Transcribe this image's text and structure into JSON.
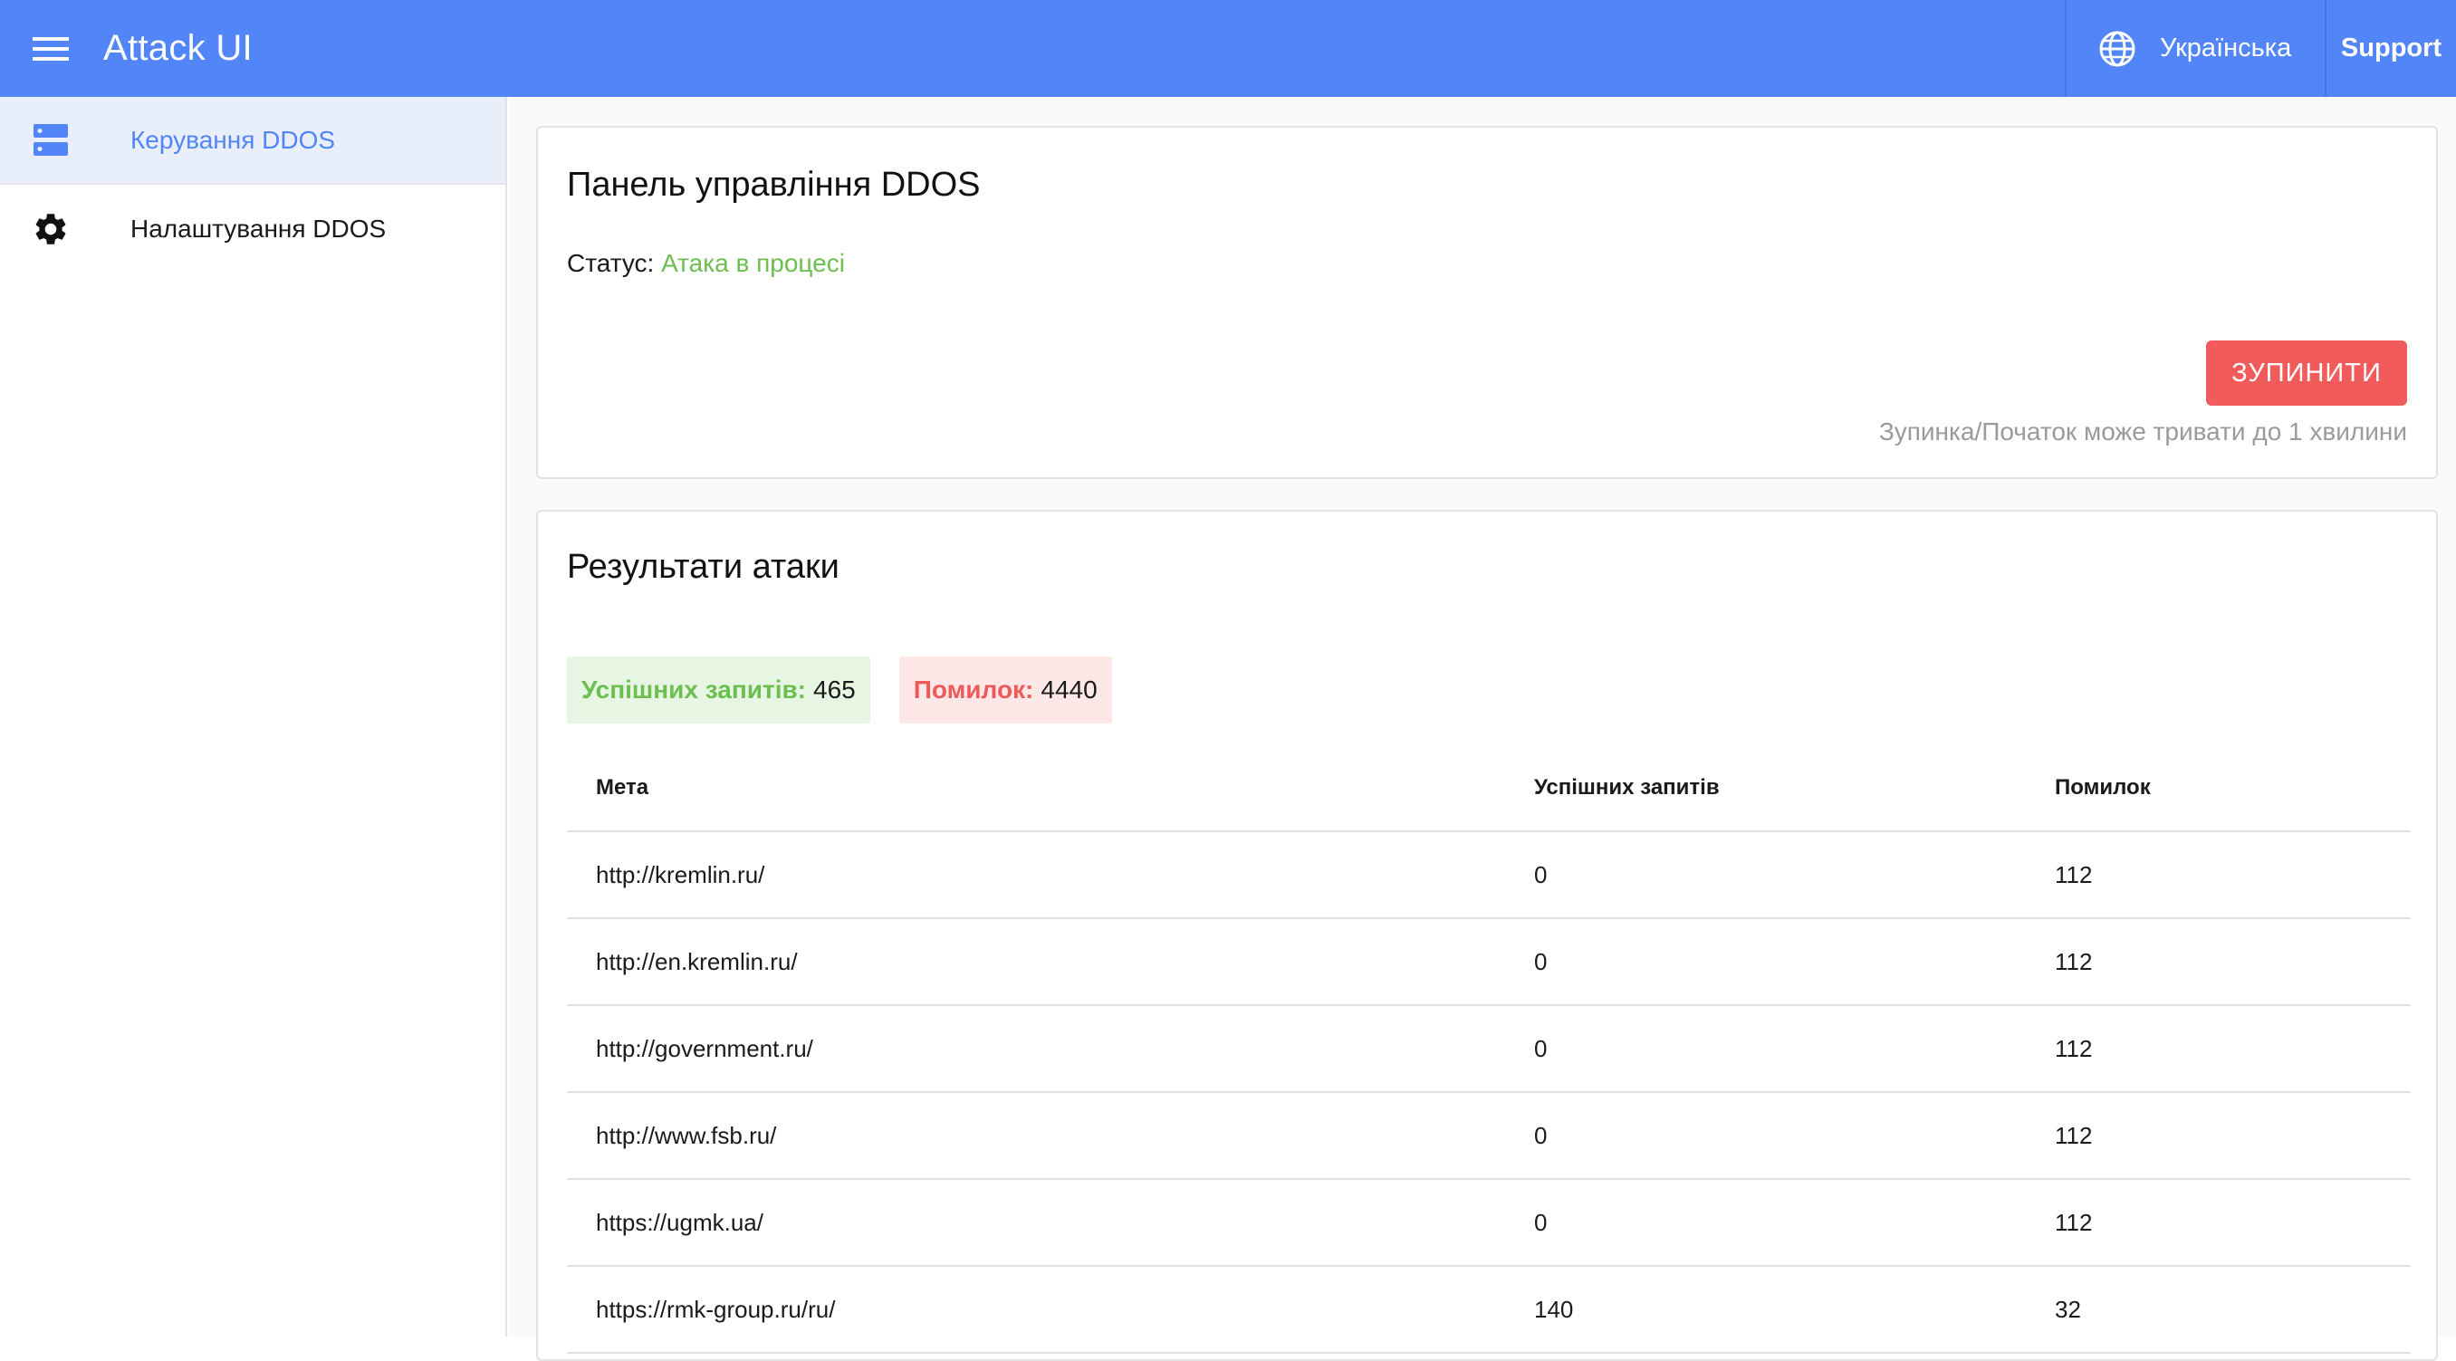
{
  "header": {
    "title": "Attack UI",
    "language": "Українська",
    "support": "Support",
    "colors": {
      "bar": "#5286f8"
    }
  },
  "sidebar": {
    "items": [
      {
        "label": "Керування DDOS",
        "icon": "server-icon",
        "active": true
      },
      {
        "label": "Налаштування DDOS",
        "icon": "gear-icon",
        "active": false
      }
    ]
  },
  "panel": {
    "title": "Панель управління DDOS",
    "status_label": "Статус:",
    "status_value": "Атака в процесі",
    "stop_button": "ЗУПИНИТИ",
    "hint": "Зупинка/Початок може тривати до 1 хвилини",
    "colors": {
      "status": "#6cbf4f",
      "stop": "#f25b5b"
    }
  },
  "results": {
    "title": "Результати атаки",
    "success_label": "Успішних запитів:",
    "success_value": "465",
    "error_label": "Помилок:",
    "error_value": "4440",
    "columns": [
      "Мета",
      "Успішних запитів",
      "Помилок"
    ],
    "rows": [
      {
        "target": "http://kremlin.ru/",
        "success": "0",
        "errors": "112"
      },
      {
        "target": "http://en.kremlin.ru/",
        "success": "0",
        "errors": "112"
      },
      {
        "target": "http://government.ru/",
        "success": "0",
        "errors": "112"
      },
      {
        "target": "http://www.fsb.ru/",
        "success": "0",
        "errors": "112"
      },
      {
        "target": "https://ugmk.ua/",
        "success": "0",
        "errors": "112"
      },
      {
        "target": "https://rmk-group.ru/ru/",
        "success": "140",
        "errors": "32"
      }
    ]
  }
}
